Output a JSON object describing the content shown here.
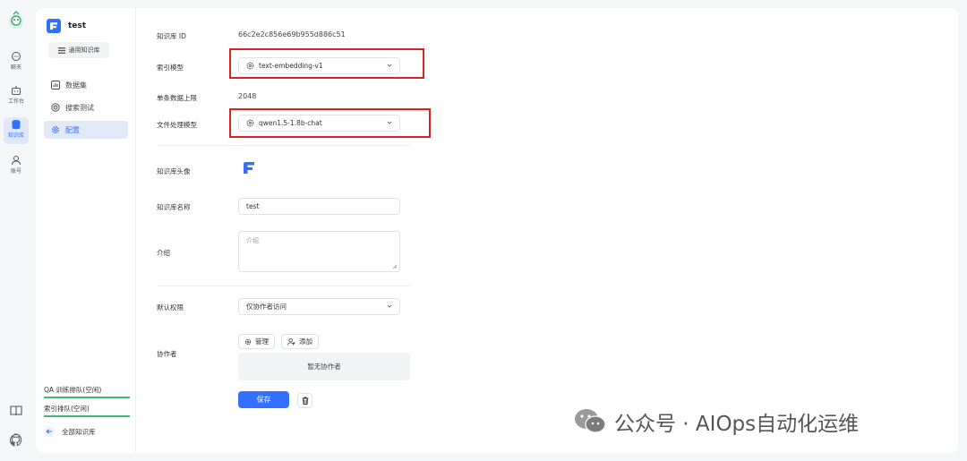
{
  "rail": {
    "items": [
      {
        "label": "聊天",
        "icon": "chat-icon"
      },
      {
        "label": "工作台",
        "icon": "robot-icon"
      },
      {
        "label": "知识库",
        "icon": "database-icon"
      },
      {
        "label": "账号",
        "icon": "user-icon"
      }
    ]
  },
  "sidebar": {
    "kb_name": "test",
    "kb_type": "通用知识库",
    "nav": [
      {
        "label": "数据集",
        "icon": "chart-icon"
      },
      {
        "label": "搜索测试",
        "icon": "target-icon"
      },
      {
        "label": "配置",
        "icon": "gear-icon"
      }
    ],
    "qa_queue": "QA 训练排队(空闲)",
    "index_queue": "索引排队(空闲)",
    "back_label": "全部知识库"
  },
  "config": {
    "kb_id_label": "知识库 ID",
    "kb_id_value": "66c2e2c856e69b955d886c51",
    "index_model_label": "索引模型",
    "index_model_value": "text-embedding-v1",
    "max_data_label": "单条数据上限",
    "max_data_value": "2048",
    "file_model_label": "文件处理模型",
    "file_model_value": "qwen1.5-1.8b-chat",
    "avatar_label": "知识库头像",
    "name_label": "知识库名称",
    "name_value": "test",
    "intro_label": "介绍",
    "intro_placeholder": "介绍",
    "permission_label": "默认权限",
    "permission_value": "仅协作者访问",
    "collab_label": "协作者",
    "manage_label": "管理",
    "add_label": "添加",
    "no_collab": "暂无协作者",
    "save_label": "保存"
  },
  "watermark": "公众号 · AIOps自动化运维",
  "colors": {
    "accent": "#3370ff",
    "highlight": "#e02020",
    "queue_bar": "#3dbb74"
  }
}
